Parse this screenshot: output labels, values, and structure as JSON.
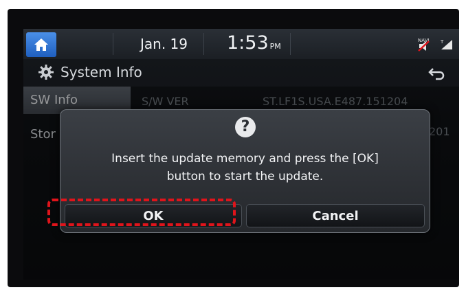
{
  "status_bar": {
    "date": "Jan. 19",
    "time": "1:53",
    "ampm": "PM",
    "icons": [
      "home-icon",
      "navi-muted-icon",
      "signal-icon"
    ]
  },
  "header": {
    "title": "System Info",
    "icons": [
      "gear-icon",
      "back-icon"
    ]
  },
  "sidebar": {
    "items": [
      {
        "label": "SW Info",
        "active": true
      },
      {
        "label": "Stor"
      }
    ]
  },
  "background_rows": [
    {
      "label": "S/W VER",
      "value": "ST.LF1S.USA.E487.151204"
    },
    {
      "value": "201"
    }
  ],
  "dialog": {
    "icon": "question-icon",
    "icon_glyph": "?",
    "message_line1": "Insert the update memory and press the [OK]",
    "message_line2": "button to start the update.",
    "ok_label": "OK",
    "cancel_label": "Cancel"
  },
  "colors": {
    "home_button": "#2f74d6",
    "highlight": "#e0141b",
    "dialog_bg": "#33373c"
  }
}
